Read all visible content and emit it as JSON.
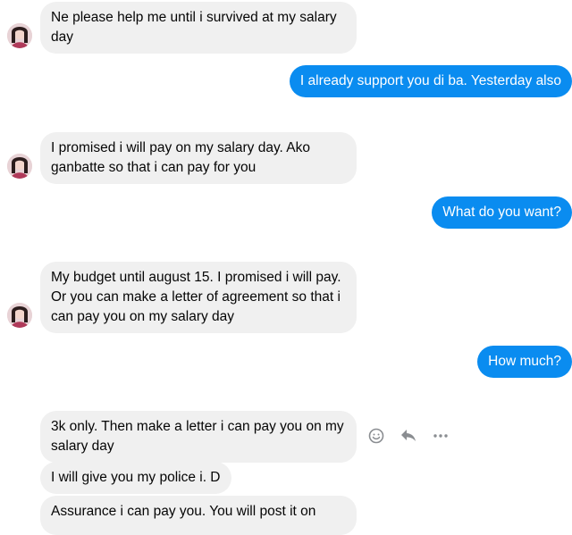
{
  "messages": [
    {
      "direction": "incoming",
      "text": "Ne please help me until i survived at my salary day"
    },
    {
      "direction": "outgoing",
      "text": "I already support you di ba. Yesterday also"
    },
    {
      "direction": "incoming",
      "text": "I promised i will pay on my salary day. Ako ganbatte so that i can pay for you"
    },
    {
      "direction": "outgoing",
      "text": "What do you want?"
    },
    {
      "direction": "incoming",
      "text": "My budget until august 15. I promised i will pay. Or you can make a letter of agreement so that i can pay you on my salary day"
    },
    {
      "direction": "outgoing",
      "text": "How much?"
    },
    {
      "direction": "incoming",
      "text": "3k only. Then make a letter i can pay you on my salary day"
    },
    {
      "direction": "incoming",
      "text": "I will give you my police i. D"
    },
    {
      "direction": "incoming",
      "text": "Assurance i can pay you. You will post it on"
    }
  ],
  "message_actions": [
    {
      "icon": "smiley-react-icon"
    },
    {
      "icon": "reply-icon"
    },
    {
      "icon": "more-icon"
    }
  ],
  "colors": {
    "incoming_bubble": "#f0f0f0",
    "outgoing_bubble": "#0a8cf0",
    "incoming_text": "#050505",
    "outgoing_text": "#ffffff",
    "icon_gray": "#8a8d91"
  }
}
